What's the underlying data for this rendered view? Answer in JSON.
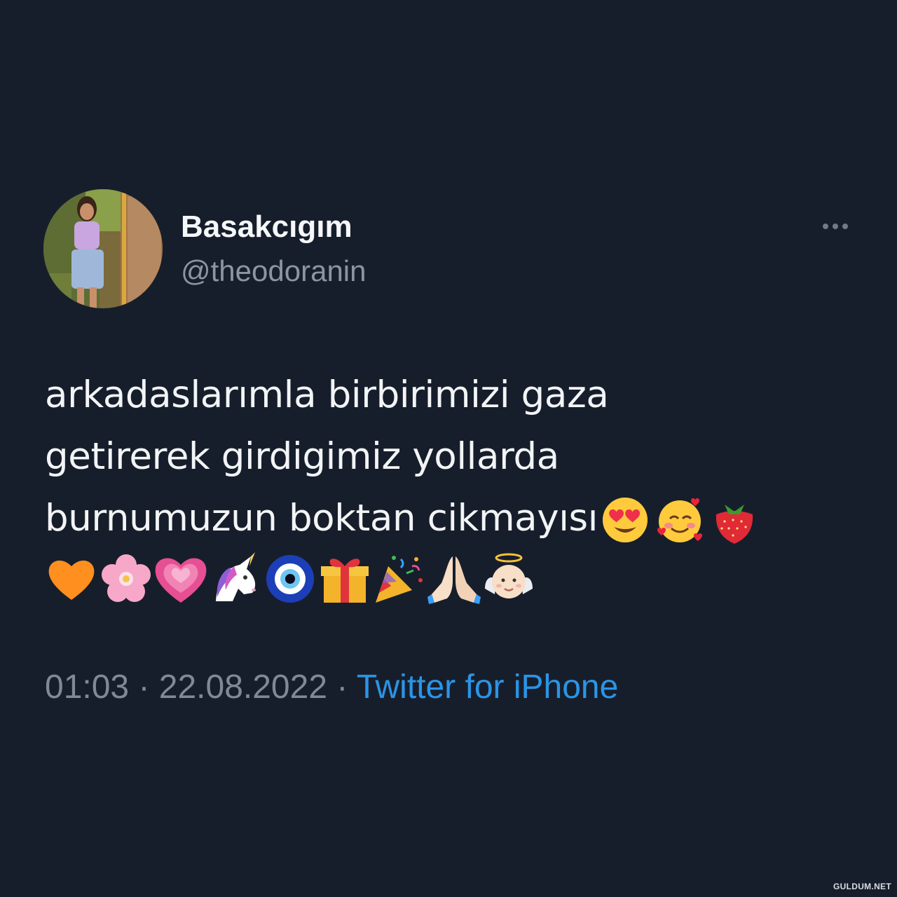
{
  "tweet": {
    "display_name": "Basakcıgım",
    "handle": "@theodoranin",
    "text_lines": [
      "arkadaslarımla birbirimizi gaza",
      "getirerek girdigimiz yollarda",
      "burnumuzun boktan cikmayısı"
    ],
    "inline_emojis": [
      "heart-eyes-face-emoji",
      "smiling-face-with-hearts-emoji",
      "strawberry-emoji"
    ],
    "emoji_row": [
      "orange-heart-emoji",
      "cherry-blossom-emoji",
      "growing-heart-emoji",
      "unicorn-emoji",
      "nazar-amulet-emoji",
      "wrapped-gift-emoji",
      "party-popper-emoji",
      "folded-hands-emoji",
      "baby-angel-emoji"
    ],
    "time": "01:03",
    "separator_1": " · ",
    "date": "22.08.2022",
    "separator_2": " · ",
    "source": "Twitter for iPhone"
  },
  "colors": {
    "background": "#171e2b",
    "text": "#f2f4f6",
    "muted": "#8a96a3",
    "link": "#2a95e6"
  },
  "watermark": "GULDUM.NET"
}
